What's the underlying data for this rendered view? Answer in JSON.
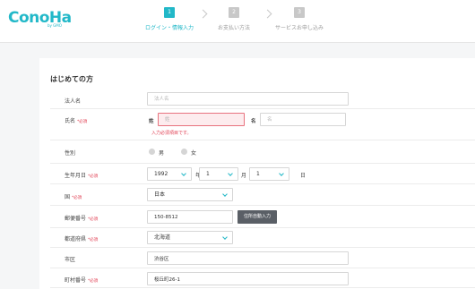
{
  "logo": {
    "main": "ConoHa",
    "sub": "by GMO"
  },
  "steps": [
    {
      "num": "1",
      "label": "ログイン・情報入力"
    },
    {
      "num": "2",
      "label": "お支払い方法"
    },
    {
      "num": "3",
      "label": "サービスお申し込み"
    }
  ],
  "section_title": "はじめての方",
  "required_mark": "*必須",
  "fields": {
    "company": {
      "label": "法人名",
      "placeholder": "法人名"
    },
    "name": {
      "label": "氏名",
      "last_label": "姓",
      "last_placeholder": "姓",
      "first_label": "名",
      "first_placeholder": "名",
      "error": "入力必須項目です。"
    },
    "gender": {
      "label": "性別",
      "male": "男",
      "female": "女"
    },
    "birthday": {
      "label": "生年月日",
      "year": "1992",
      "year_unit": "年",
      "month": "1",
      "month_unit": "月",
      "day": "1",
      "day_unit": "日"
    },
    "country": {
      "label": "国",
      "value": "日本"
    },
    "postal": {
      "label": "郵便番号",
      "value": "150-8512",
      "button": "住所自動入力"
    },
    "prefecture": {
      "label": "都道府県",
      "value": "北海道"
    },
    "city": {
      "label": "市区",
      "value": "渋谷区"
    },
    "street": {
      "label": "町村番号",
      "value": "桜丘町26-1"
    }
  }
}
